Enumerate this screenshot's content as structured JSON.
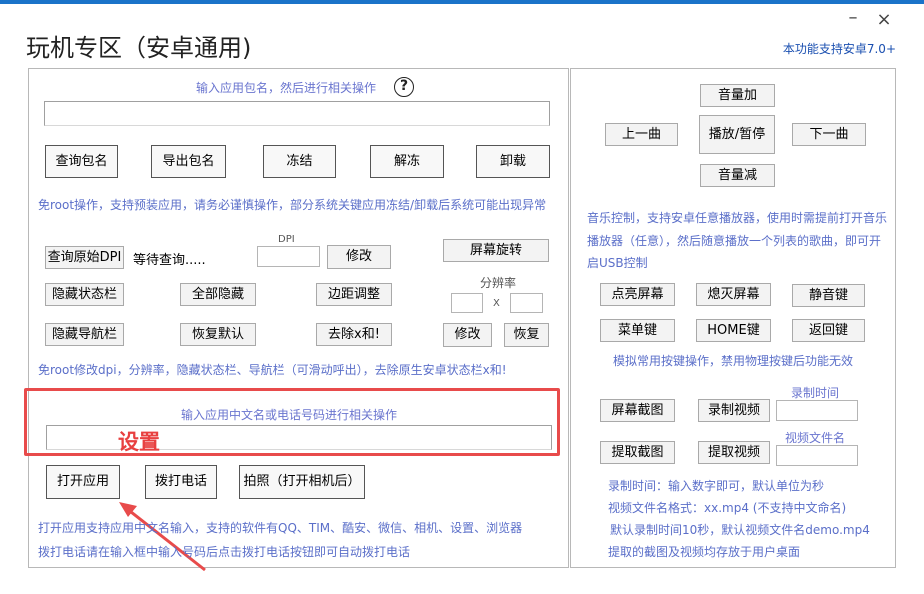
{
  "window": {
    "title": "玩机专区（安卓通用)",
    "version_note": "本功能支持安卓7.0+",
    "minimize_glyph": "–",
    "close_glyph": "×"
  },
  "package": {
    "hint": "输入应用包名，然后进行相关操作",
    "help_glyph": "?",
    "input_value": "",
    "buttons": [
      "查询包名",
      "导出包名",
      "冻结",
      "解冻",
      "卸载"
    ],
    "warning": "免root操作，支持预装应用，请务必谨慎操作，部分系统关键应用冻结/卸载后系统可能出现异常"
  },
  "display": {
    "query_dpi": "查询原始DPI",
    "waiting": "等待查询.....",
    "dpi_label": "DPI",
    "modify": "修改",
    "rotate": "屏幕旋转",
    "hide_status": "隐藏状态栏",
    "hide_all": "全部隐藏",
    "margin_adjust": "边距调整",
    "resolution_label": "分辨率",
    "x_label": "X",
    "hide_nav": "隐藏导航栏",
    "restore_default": "恢复默认",
    "remove_xhe": "去除x和!",
    "modify2": "修改",
    "restore": "恢复",
    "note": "免root修改dpi，分辨率，隐藏状态栏、导航栏（可滑动呼出），去除原生安卓状态栏x和!"
  },
  "app": {
    "hint": "输入应用中文名或电话号码进行相关操作",
    "input_value": "",
    "annotation": "设置",
    "open_app": "打开应用",
    "call": "拨打电话",
    "photo": "拍照（打开相机后）",
    "note1": "打开应用支持应用中文名输入，支持的软件有QQ、TIM、酷安、微信、相机、设置、浏览器",
    "note2": "拨打电话请在输入框中输入号码后点击拨打电话按钮即可自动拨打电话"
  },
  "music": {
    "vol_up": "音量加",
    "prev": "上一曲",
    "play_pause": "播放/暂停",
    "next": "下一曲",
    "vol_down": "音量减",
    "note_line1": "音乐控制，支持安卓任意播放器，使用时需提前打开音乐",
    "note_line2": "播放器（任意），然后随意播放一个列表的歌曲，即可开",
    "note_line3": "启USB控制"
  },
  "keys": {
    "screen_on": "点亮屏幕",
    "screen_off": "熄灭屏幕",
    "mute": "静音键",
    "menu": "菜单键",
    "home": "HOME键",
    "back": "返回键",
    "note": "模拟常用按键操作，禁用物理按键后功能无效"
  },
  "capture": {
    "record_time_label": "录制时间",
    "screenshot": "屏幕截图",
    "record_video": "录制视频",
    "record_time_value": "",
    "video_name_label": "视频文件名",
    "extract_screenshot": "提取截图",
    "extract_video": "提取视频",
    "video_name_value": "",
    "note1": "录制时间：输入数字即可，默认单位为秒",
    "note2": "视频文件名格式：xx.mp4 (不支持中文命名)",
    "note3": "默认录制时间10秒，默认视频文件名demo.mp4",
    "note4": "提取的截图及视频均存放于用户桌面"
  },
  "colors": {
    "accent_blue": "#1a73c9",
    "hint_text": "#5b6fc9",
    "annotation_red": "#e84b4b"
  }
}
